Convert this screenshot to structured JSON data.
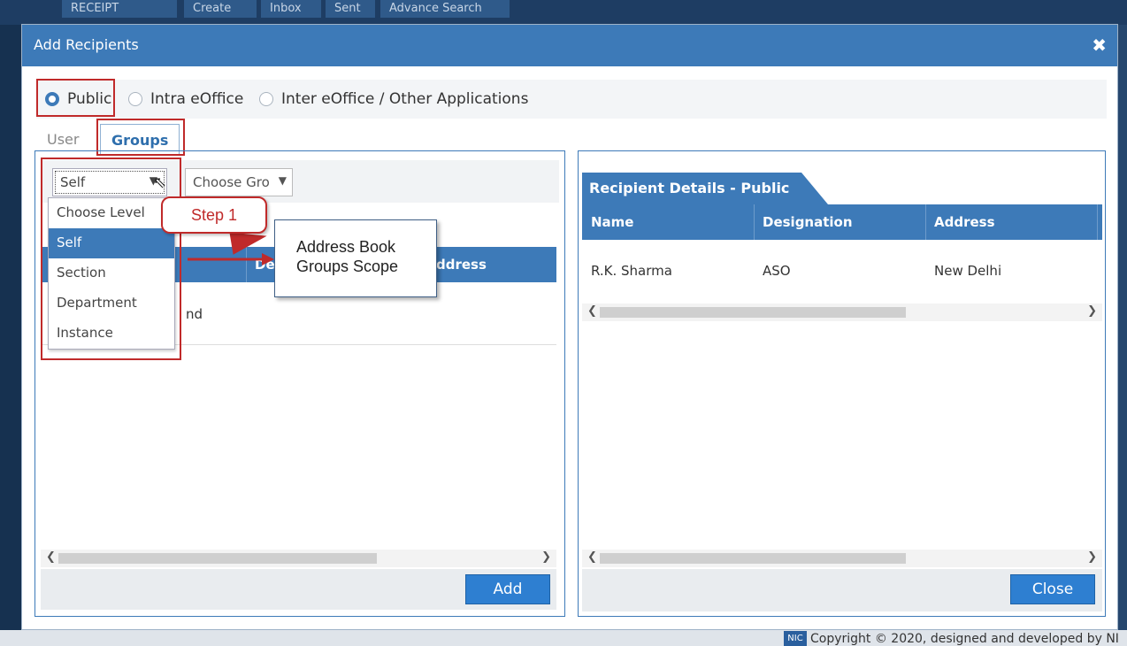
{
  "background": {
    "top_tabs": [
      "RECEIPT",
      "Create",
      "Inbox",
      "Sent",
      "Advance Search"
    ],
    "footer_badge": "NIC",
    "footer_text": "Copyright © 2020, designed and developed by NI"
  },
  "modal": {
    "title": "Add Recipients",
    "close_glyph": "✖"
  },
  "recipient_type": {
    "options": [
      "Public",
      "Intra eOffice",
      "Inter eOffice / Other Applications"
    ],
    "selected": "Public"
  },
  "tabs": [
    "User",
    "Groups"
  ],
  "active_tab": "Groups",
  "left_panel": {
    "level_select_value": "Self",
    "group_select_value": "Choose Gro",
    "level_options": [
      "Choose Level",
      "Self",
      "Section",
      "Department",
      "Instance"
    ],
    "level_selected": "Self",
    "table_columns_visible": [
      "De",
      "ddress"
    ],
    "row_text_visible": "nd",
    "add_label": "Add"
  },
  "annotations": {
    "step_label": "Step 1",
    "scope_line1": "Address Book",
    "scope_line2": "Groups Scope"
  },
  "right_panel": {
    "title": "Recipient Details - Public",
    "columns": [
      "Name",
      "Designation",
      "Address"
    ],
    "rows": [
      {
        "name": "R.K. Sharma",
        "designation": "ASO",
        "address": "New Delhi"
      }
    ],
    "close_label": "Close"
  },
  "colors": {
    "header_blue": "#3d7ab8",
    "highlight_red": "#c02a2a",
    "button_blue": "#2e7fd1"
  }
}
